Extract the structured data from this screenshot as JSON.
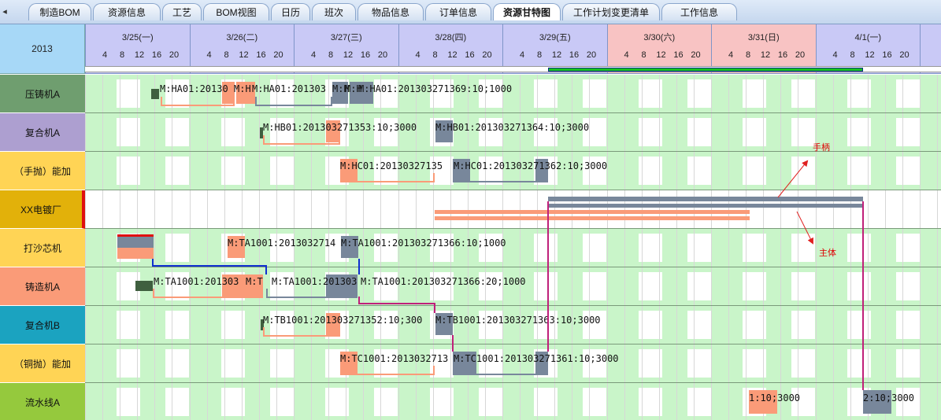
{
  "tabs": [
    {
      "label": "制造BOM",
      "active": false
    },
    {
      "label": "资源信息",
      "active": false
    },
    {
      "label": "工艺",
      "active": false
    },
    {
      "label": "BOM视图",
      "active": false
    },
    {
      "label": "日历",
      "active": false
    },
    {
      "label": "班次",
      "active": false
    },
    {
      "label": "物品信息",
      "active": false
    },
    {
      "label": "订单信息",
      "active": false
    },
    {
      "label": "资源甘特图",
      "active": true
    },
    {
      "label": "工作计划变更清单",
      "active": false
    },
    {
      "label": "工作信息",
      "active": false
    }
  ],
  "tab_scroll_icon": "left-arrow-icon",
  "gantt": {
    "year": "2013",
    "hour_ticks": [
      "4",
      "8",
      "12",
      "16",
      "20"
    ],
    "days": [
      {
        "label": "3/25(一)",
        "color": "#c9c9f6"
      },
      {
        "label": "3/26(二)",
        "color": "#c9c9f6"
      },
      {
        "label": "3/27(三)",
        "color": "#c9c9f6"
      },
      {
        "label": "3/28(四)",
        "color": "#c9c9f6"
      },
      {
        "label": "3/29(五)",
        "color": "#c9c9f6"
      },
      {
        "label": "3/30(六)",
        "color": "#f8c3c3"
      },
      {
        "label": "3/31(日)",
        "color": "#f8c3c3"
      },
      {
        "label": "4/1(一)",
        "color": "#c9c9f6"
      },
      {
        "label": "4",
        "color": "#c9c9f6"
      }
    ],
    "resources": [
      {
        "name": "压铸机A",
        "color": "#6f9e6f"
      },
      {
        "name": "复合机A",
        "color": "#ad9fd0"
      },
      {
        "name": "（手抛）能加",
        "color": "#ffd455"
      },
      {
        "name": "XX电镀厂",
        "color": "#e2b10a"
      },
      {
        "name": "打沙芯机",
        "color": "#ffd455"
      },
      {
        "name": "铸造机A",
        "color": "#fa9b78"
      },
      {
        "name": "复合机B",
        "color": "#1ba3c0"
      },
      {
        "name": "（铜抛）能加",
        "color": "#ffd455"
      },
      {
        "name": "流水线A",
        "color": "#95c93d"
      }
    ],
    "bar_labels": {
      "HA_1": "M:HA01:20130",
      "HA_2": "M:H",
      "HA_3": "M:HA01:201303",
      "HA_4": "M:H",
      "HA_5": "M:H",
      "HA_6": "M:HA01:201303271369:10;1000",
      "HB_1": "M:HB01:201303271353:10;3000",
      "HB_2": "M:HB01:201303271364:10;3000",
      "HC_1": "M:HC01:20130327135",
      "HC_2": "M:HC01:201303271362:10;3000",
      "TA_1": "M:TA1001:2013032714",
      "TA_2": "M:TA1001:201303271366:10;1000",
      "MA_1": "M:TA1001:201303",
      "MA_2": "M:T",
      "MA_3": "M:TA1001:201303",
      "MA_4": "M:TA1001:201303271366:20;1000",
      "TB_1": "M:TB1001:201303271352:10;300",
      "TB_2": "M:TB1001:201303271363:10;3000",
      "TC_1": "M:TC1001:2013032713",
      "TC_2": "M:TC1001:201303271361:10;3000",
      "LA_1": "1:10;3000",
      "LA_2": "2:10;3000"
    },
    "callouts": {
      "handle": "手柄",
      "body": "主体"
    }
  }
}
